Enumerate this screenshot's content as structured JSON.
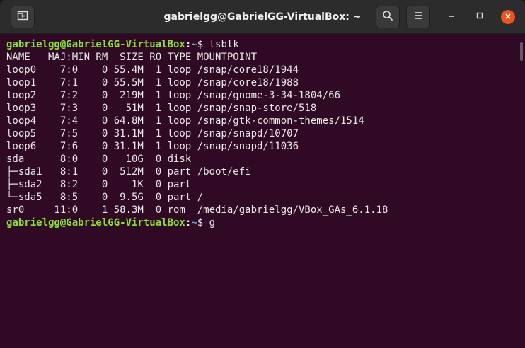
{
  "window": {
    "title": "gabrielgg@GabrielGG-VirtualBox: ~"
  },
  "icons": {
    "new_tab": "new-tab-icon",
    "search": "search-icon",
    "menu": "hamburger-menu-icon",
    "minimize": "minimize-icon",
    "maximize": "maximize-icon",
    "close": "close-icon"
  },
  "colors": {
    "background": "#300a24",
    "titlebar": "#2c2c2c",
    "prompt_user": "#8ae234",
    "prompt_path": "#729fcf",
    "close_button": "#e95420"
  },
  "terminal": {
    "prompt1": {
      "user_host": "gabrielgg@GabrielGG-VirtualBox",
      "sep": ":",
      "path": "~",
      "symbol": "$ ",
      "command": "lsblk"
    },
    "output": [
      "NAME   MAJ:MIN RM  SIZE RO TYPE MOUNTPOINT",
      "loop0    7:0    0 55.4M  1 loop /snap/core18/1944",
      "loop1    7:1    0 55.5M  1 loop /snap/core18/1988",
      "loop2    7:2    0  219M  1 loop /snap/gnome-3-34-1804/66",
      "loop3    7:3    0   51M  1 loop /snap/snap-store/518",
      "loop4    7:4    0 64.8M  1 loop /snap/gtk-common-themes/1514",
      "loop5    7:5    0 31.1M  1 loop /snap/snapd/10707",
      "loop6    7:6    0 31.1M  1 loop /snap/snapd/11036",
      "sda      8:0    0   10G  0 disk ",
      "├─sda1   8:1    0  512M  0 part /boot/efi",
      "├─sda2   8:2    0    1K  0 part ",
      "└─sda5   8:5    0  9.5G  0 part /",
      "sr0     11:0    1 58.3M  0 rom  /media/gabrielgg/VBox_GAs_6.1.18"
    ],
    "prompt2": {
      "user_host": "gabrielgg@GabrielGG-VirtualBox",
      "sep": ":",
      "path": "~",
      "symbol": "$ ",
      "command": "g"
    }
  }
}
